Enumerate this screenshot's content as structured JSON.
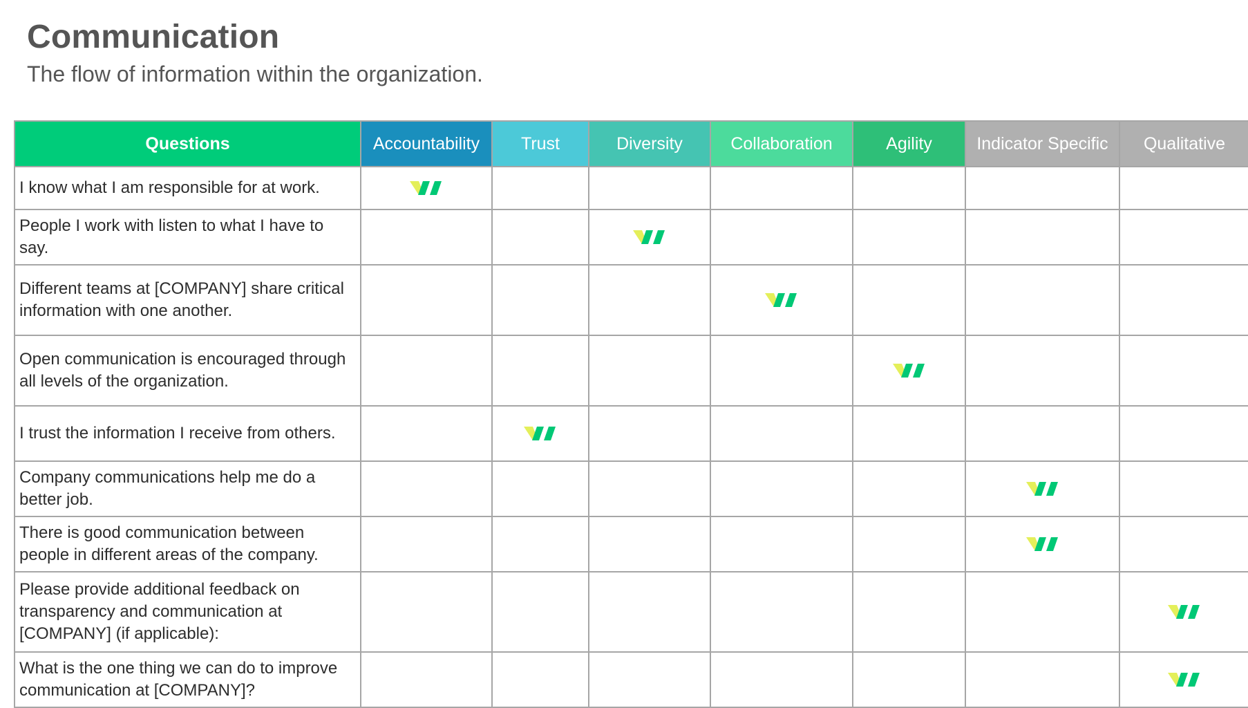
{
  "header": {
    "title": "Communication",
    "subtitle": "The flow of information within the organization."
  },
  "table": {
    "question_header": "Questions",
    "columns": [
      {
        "key": "accountability",
        "label": "Accountability",
        "color": "#1a8fbd"
      },
      {
        "key": "trust",
        "label": "Trust",
        "color": "#4cc9d8"
      },
      {
        "key": "diversity",
        "label": "Diversity",
        "color": "#45c4b2"
      },
      {
        "key": "collaboration",
        "label": "Collaboration",
        "color": "#4cdb9c"
      },
      {
        "key": "agility",
        "label": "Agility",
        "color": "#2ebf78"
      },
      {
        "key": "indicator_specific",
        "label": "Indicator Specific",
        "color": "#b0b0b0"
      },
      {
        "key": "qualitative",
        "label": "Qualitative",
        "color": "#b0b0b0"
      }
    ],
    "question_header_color": "#00cc7a",
    "rows": [
      {
        "question": "I know what I am responsible for at work.",
        "mark": "accountability"
      },
      {
        "question": "People I work with listen to what I have to say.",
        "mark": "diversity"
      },
      {
        "question": "Different teams at [COMPANY] share critical information with one another.",
        "mark": "collaboration"
      },
      {
        "question": "Open communication is encouraged through all levels of the organization.",
        "mark": "agility"
      },
      {
        "question": "I trust the information I receive from others.",
        "mark": "trust"
      },
      {
        "question": "Company communications help me do a better job.",
        "mark": "indicator_specific"
      },
      {
        "question": "There is good communication between people in different areas of the company.",
        "mark": "indicator_specific"
      },
      {
        "question": "Please provide additional feedback on transparency and communication at [COMPANY] (if applicable):",
        "mark": "qualitative"
      },
      {
        "question": "What is the one thing we can do to improve communication at [COMPANY]?",
        "mark": "qualitative"
      }
    ]
  },
  "icons": {
    "mark_icon": "check-mark-icon",
    "mark_colors": {
      "left": "#e4ef5a",
      "right": "#00c875"
    }
  }
}
